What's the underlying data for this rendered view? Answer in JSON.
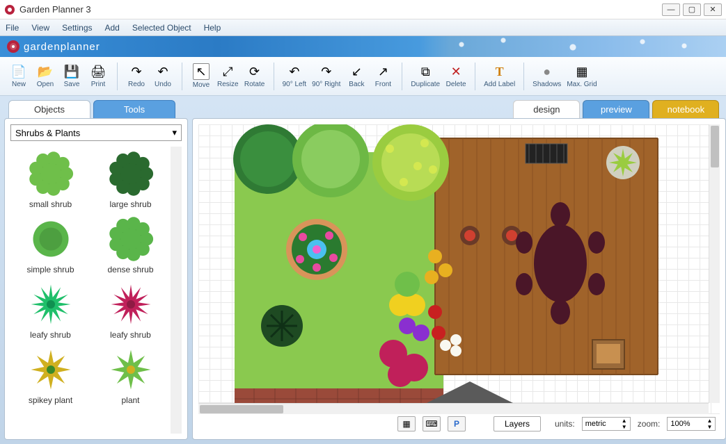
{
  "window": {
    "title": "Garden Planner 3"
  },
  "menu": [
    "File",
    "View",
    "Settings",
    "Add",
    "Selected Object",
    "Help"
  ],
  "brand": {
    "text": "gardenplanner"
  },
  "toolbar": [
    {
      "icon": "new-icon",
      "label": "New",
      "glyph": "📄"
    },
    {
      "icon": "open-icon",
      "label": "Open",
      "glyph": "📂"
    },
    {
      "icon": "save-icon",
      "label": "Save",
      "glyph": "💾"
    },
    {
      "icon": "print-icon",
      "label": "Print",
      "glyph": "🖨"
    },
    {
      "sep": true
    },
    {
      "icon": "redo-icon",
      "label": "Redo",
      "glyph": "↷"
    },
    {
      "icon": "undo-icon",
      "label": "Undo",
      "glyph": "↶"
    },
    {
      "sep": true
    },
    {
      "icon": "move-icon",
      "label": "Move",
      "glyph": "↖"
    },
    {
      "icon": "resize-icon",
      "label": "Resize",
      "glyph": "⤢"
    },
    {
      "icon": "rotate-icon",
      "label": "Rotate",
      "glyph": "⟳"
    },
    {
      "sep": true
    },
    {
      "icon": "rotleft-icon",
      "label": "90° Left",
      "glyph": "↶"
    },
    {
      "icon": "rotright-icon",
      "label": "90° Right",
      "glyph": "↷"
    },
    {
      "icon": "back-icon",
      "label": "Back",
      "glyph": "↙"
    },
    {
      "icon": "front-icon",
      "label": "Front",
      "glyph": "↗"
    },
    {
      "sep": true
    },
    {
      "icon": "duplicate-icon",
      "label": "Duplicate",
      "glyph": "⧉"
    },
    {
      "icon": "delete-icon",
      "label": "Delete",
      "glyph": "✕"
    },
    {
      "sep": true
    },
    {
      "icon": "addlabel-icon",
      "label": "Add Label",
      "glyph": "T"
    },
    {
      "sep": true
    },
    {
      "icon": "shadows-icon",
      "label": "Shadows",
      "glyph": "●"
    },
    {
      "icon": "maxgrid-icon",
      "label": "Max. Grid",
      "glyph": "▦"
    }
  ],
  "leftTabs": {
    "objects": "Objects",
    "tools": "Tools"
  },
  "category": "Shrubs & Plants",
  "objects": [
    {
      "name": "small shrub",
      "color1": "#6fbf4a",
      "color2": "#4f9a34",
      "shape": "fluff"
    },
    {
      "name": "large shrub",
      "color1": "#2a6a2f",
      "color2": "#1e4a22",
      "shape": "fluff"
    },
    {
      "name": "simple shrub",
      "color1": "#5ab54a",
      "color2": "#3f8a36",
      "shape": "blob"
    },
    {
      "name": "dense shrub",
      "color1": "#5ab54a",
      "color2": "#3f8a36",
      "shape": "fluff"
    },
    {
      "name": "leafy shrub",
      "color1": "#1fbf6a",
      "color2": "#0f9050",
      "shape": "spike"
    },
    {
      "name": "leafy shrub",
      "color1": "#c0205a",
      "color2": "#8f1a44",
      "shape": "spike"
    },
    {
      "name": "spikey plant",
      "color1": "#d0b020",
      "color2": "#3a8a2a",
      "shape": "star"
    },
    {
      "name": "plant",
      "color1": "#6fbf4a",
      "color2": "#d0b020",
      "shape": "star"
    }
  ],
  "rightTabs": {
    "design": "design",
    "preview": "preview",
    "notebook": "notebook"
  },
  "status": {
    "layers": "Layers",
    "unitsLabel": "units:",
    "units": "metric",
    "zoomLabel": "zoom:",
    "zoom": "100%"
  }
}
